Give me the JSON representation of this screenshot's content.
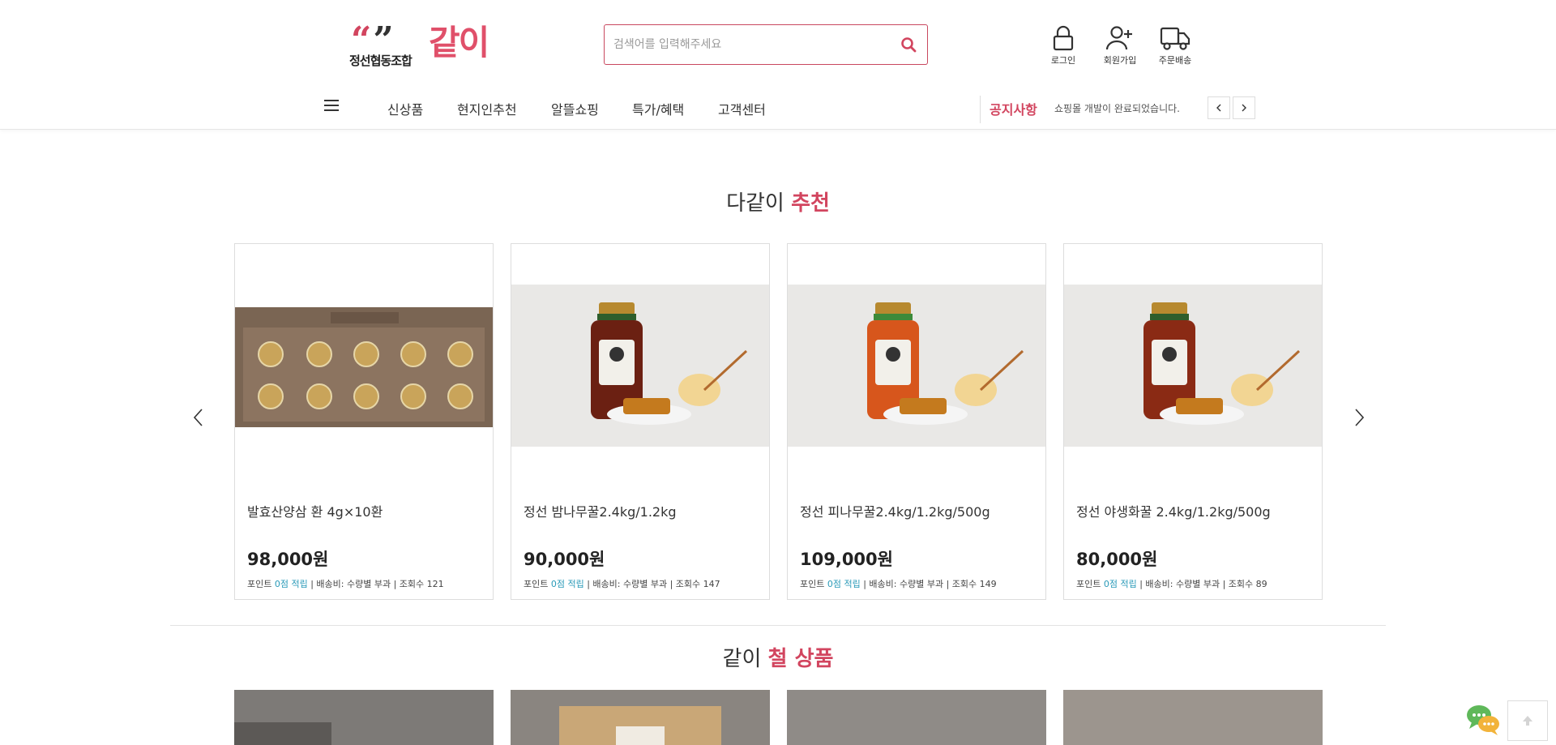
{
  "header": {
    "logo": {
      "org": "정선협동조합",
      "brand": "같이"
    },
    "search": {
      "placeholder": "검색어를 입력해주세요"
    },
    "util": [
      {
        "label": "로그인",
        "icon": "lock-icon"
      },
      {
        "label": "회원가입",
        "icon": "user-plus-icon"
      },
      {
        "label": "주문배송",
        "icon": "truck-icon"
      }
    ]
  },
  "nav": {
    "items": [
      "신상품",
      "현지인추천",
      "알뜰쇼핑",
      "특가/혜택",
      "고객센터"
    ],
    "notice_title": "공지사항",
    "notice_text": "쇼핑몰 개발이 완료되었습니다."
  },
  "colors": {
    "accent": "#d2455f",
    "point": "#2a9ab8"
  },
  "section1": {
    "title_plain": "다같이",
    "title_highlight": "추천",
    "products": [
      {
        "name": "발효산양삼 환 4g×10환",
        "price": "98,000원",
        "point_label": "포인트",
        "point": "0점 적립",
        "rest": " | 배송비: 수량별 부과 | 조회수 121"
      },
      {
        "name": "정선 밤나무꿀2.4kg/1.2kg",
        "price": "90,000원",
        "point_label": "포인트",
        "point": "0점 적립",
        "rest": " | 배송비: 수량별 부과 | 조회수 147"
      },
      {
        "name": "정선 피나무꿀2.4kg/1.2kg/500g",
        "price": "109,000원",
        "point_label": "포인트",
        "point": "0점 적립",
        "rest": " | 배송비: 수량별 부과 | 조회수 149"
      },
      {
        "name": "정선 야생화꿀 2.4kg/1.2kg/500g",
        "price": "80,000원",
        "point_label": "포인트",
        "point": "0점 적립",
        "rest": " | 배송비: 수량별 부과 | 조회수 89"
      }
    ]
  },
  "section2": {
    "title_plain": "같이",
    "title_highlight": "철 상품"
  }
}
